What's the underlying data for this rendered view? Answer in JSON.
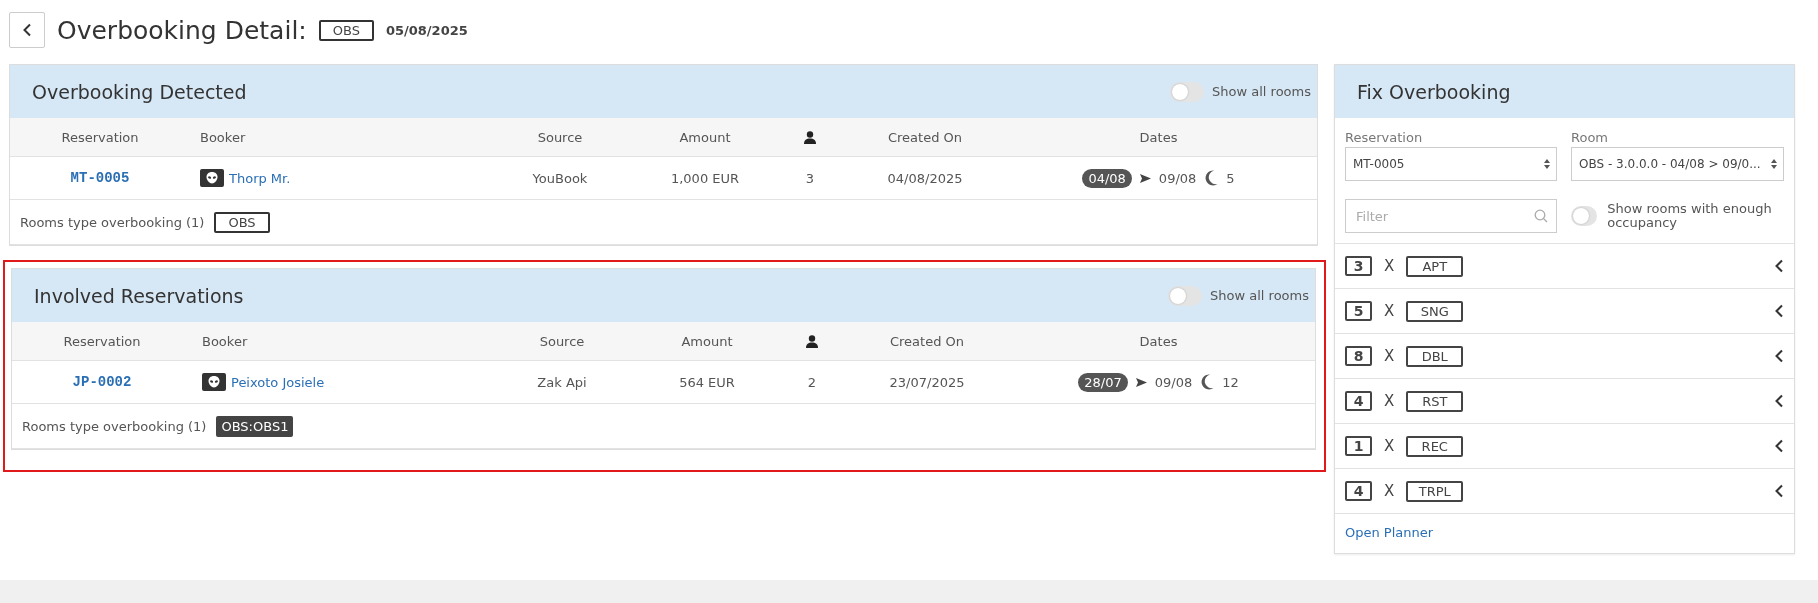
{
  "header": {
    "title": "Overbooking Detail:",
    "room_type": "OBS",
    "date": "05/08/2025"
  },
  "panels": [
    {
      "title": "Overbooking Detected",
      "highlighted": false,
      "toggle": {
        "label": "Show all rooms",
        "on": false
      },
      "columns": [
        {
          "kind": "text",
          "label": "Reservation"
        },
        {
          "kind": "text",
          "label": "Booker"
        },
        {
          "kind": "text",
          "label": "Source"
        },
        {
          "kind": "text",
          "label": "Amount"
        },
        {
          "kind": "guests"
        },
        {
          "kind": "text",
          "label": "Created On"
        },
        {
          "kind": "text",
          "label": "Dates"
        }
      ],
      "rows": [
        {
          "reservation": "MT-0005",
          "booker": "Thorp Mr.",
          "source": "YouBook",
          "amount": "1,000 EUR",
          "guests": "3",
          "created_on": "04/08/2025",
          "date_from": "04/08",
          "date_to": "09/08",
          "nights": "5"
        }
      ],
      "footer": {
        "label": "Rooms type overbooking (1)",
        "tag": "OBS",
        "tag_filled": false
      }
    },
    {
      "title": "Involved Reservations",
      "highlighted": true,
      "toggle": {
        "label": "Show all rooms",
        "on": false
      },
      "columns": [
        {
          "kind": "text",
          "label": "Reservation"
        },
        {
          "kind": "text",
          "label": "Booker"
        },
        {
          "kind": "text",
          "label": "Source"
        },
        {
          "kind": "text",
          "label": "Amount"
        },
        {
          "kind": "guests"
        },
        {
          "kind": "text",
          "label": "Created On"
        },
        {
          "kind": "text",
          "label": "Dates"
        }
      ],
      "rows": [
        {
          "reservation": "JP-0002",
          "booker": "Peixoto Josiele",
          "source": "Zak Api",
          "amount": "564 EUR",
          "guests": "2",
          "created_on": "23/07/2025",
          "date_from": "28/07",
          "date_to": "09/08",
          "nights": "12"
        }
      ],
      "footer": {
        "label": "Rooms type overbooking (1)",
        "tag": "OBS:OBS1",
        "tag_filled": true
      }
    }
  ],
  "fix": {
    "title": "Fix Overbooking",
    "reservation": {
      "label": "Reservation",
      "value": "MT-0005"
    },
    "room": {
      "label": "Room",
      "value": "OBS - 3.0.0.0 - 04/08 > 09/0..."
    },
    "filter": {
      "placeholder": "Filter"
    },
    "occupancy_toggle": {
      "label": "Show rooms with enough occupancy",
      "on": false
    },
    "room_types": [
      {
        "count": "3",
        "separator": "X",
        "code": "APT"
      },
      {
        "count": "5",
        "separator": "X",
        "code": "SNG"
      },
      {
        "count": "8",
        "separator": "X",
        "code": "DBL"
      },
      {
        "count": "4",
        "separator": "X",
        "code": "RST"
      },
      {
        "count": "1",
        "separator": "X",
        "code": "REC"
      },
      {
        "count": "4",
        "separator": "X",
        "code": "TRPL"
      }
    ],
    "link": "Open Planner"
  }
}
